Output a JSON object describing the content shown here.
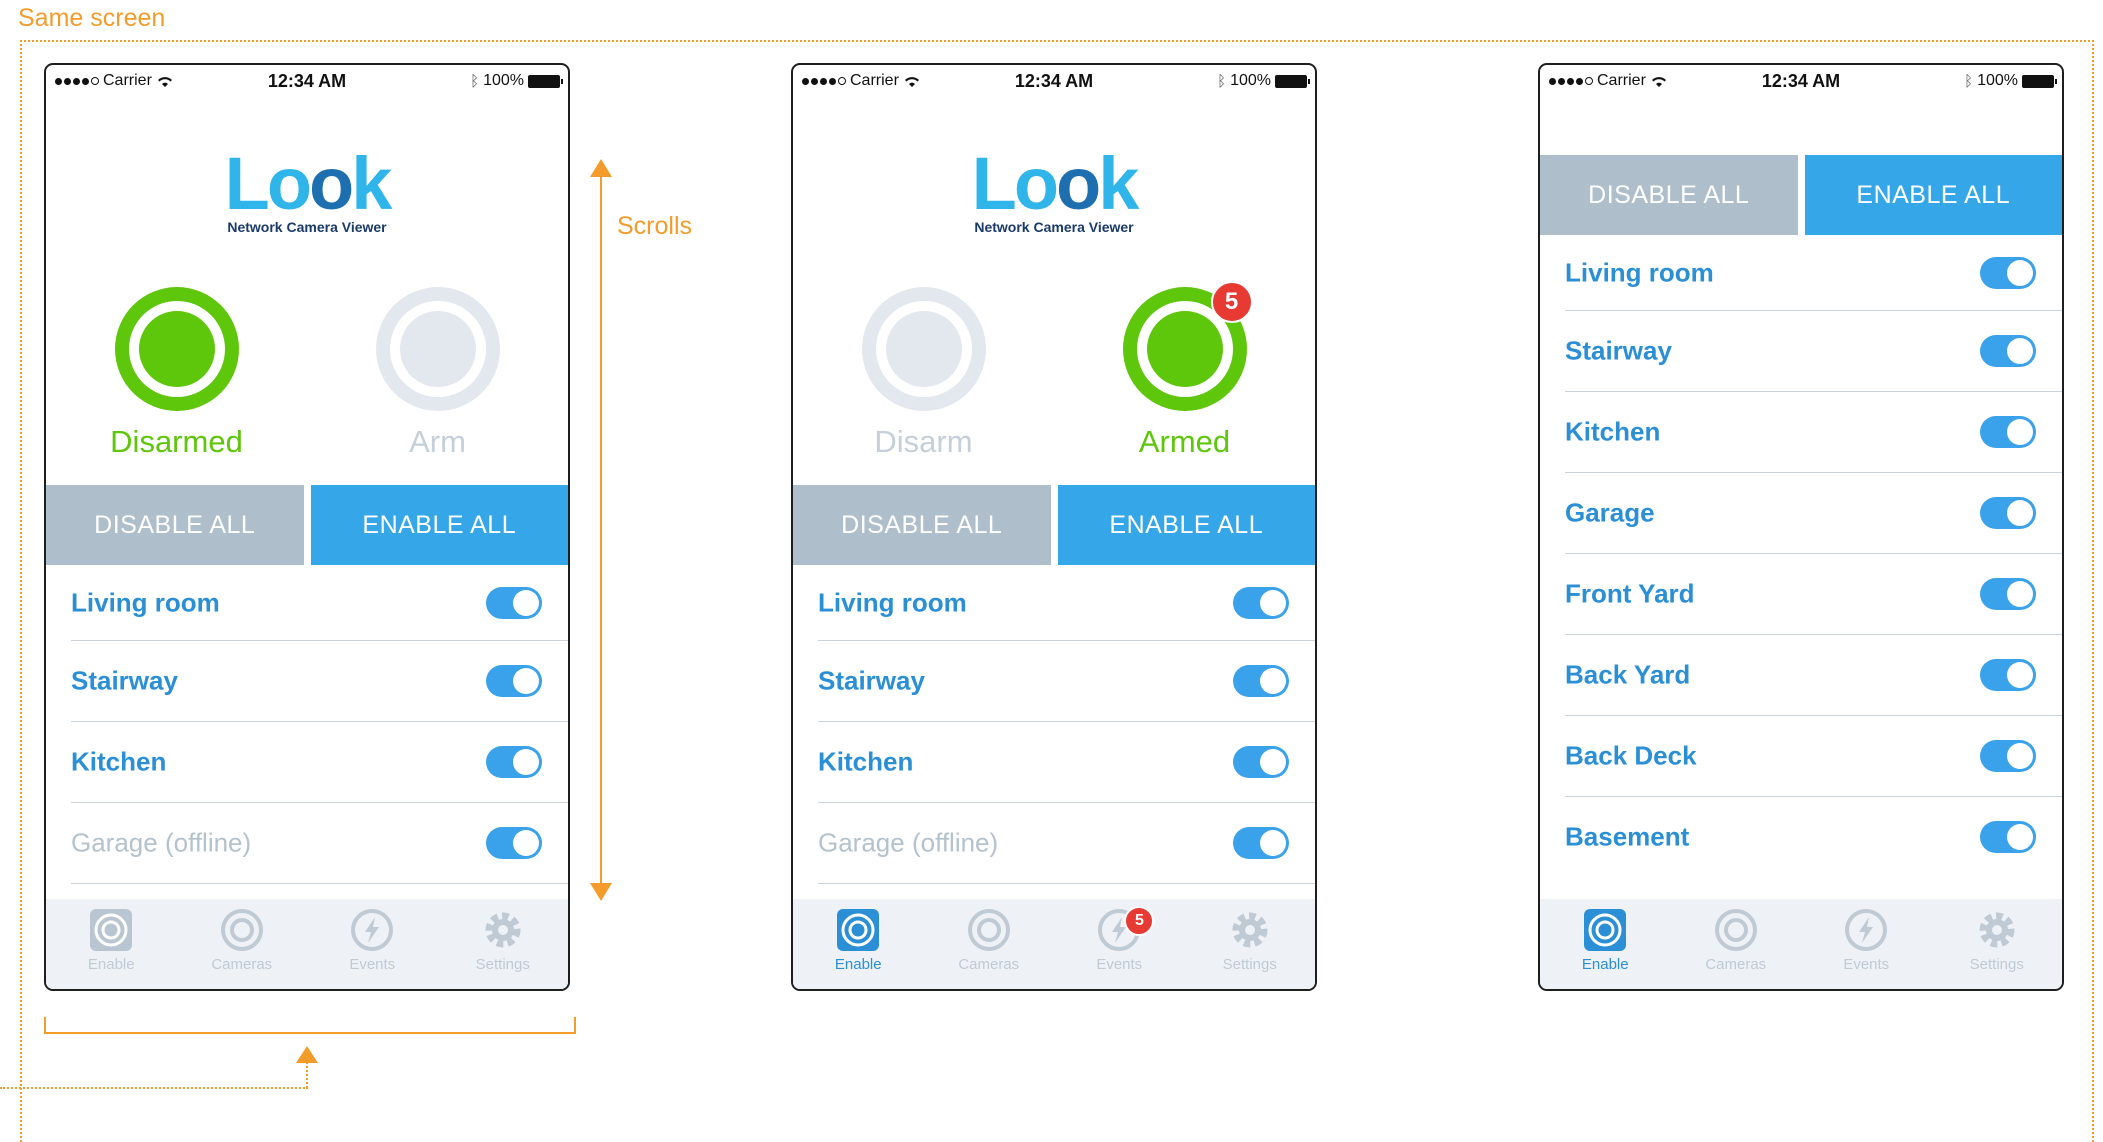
{
  "annotations": {
    "same_screen": "Same screen",
    "scrolls": "Scrolls"
  },
  "status": {
    "carrier": "Carrier",
    "time": "12:34 AM",
    "battery": "100%"
  },
  "logo": {
    "word": "Look",
    "subtitle": "Network Camera Viewer"
  },
  "buttons": {
    "disable_all": "DISABLE ALL",
    "enable_all": "ENABLE ALL"
  },
  "phone1": {
    "left_label": "Disarmed",
    "right_label": "Arm",
    "rows": [
      "Living room",
      "Stairway",
      "Kitchen",
      "Garage (offline)"
    ]
  },
  "phone2": {
    "left_label": "Disarm",
    "right_label": "Armed",
    "armed_badge": "5",
    "events_badge": "5",
    "rows": [
      "Living room",
      "Stairway",
      "Kitchen",
      "Garage (offline)"
    ]
  },
  "phone3": {
    "rows": [
      "Living room",
      "Stairway",
      "Kitchen",
      "Garage",
      "Front Yard",
      "Back Yard",
      "Back Deck",
      "Basement"
    ]
  },
  "tabs": {
    "enable": "Enable",
    "cameras": "Cameras",
    "events": "Events",
    "settings": "Settings"
  },
  "colors": {
    "accent_blue": "#35a7e9",
    "armed_green": "#5ec60b",
    "badge_red": "#e63a32",
    "annotation_orange": "#f39c2b"
  }
}
